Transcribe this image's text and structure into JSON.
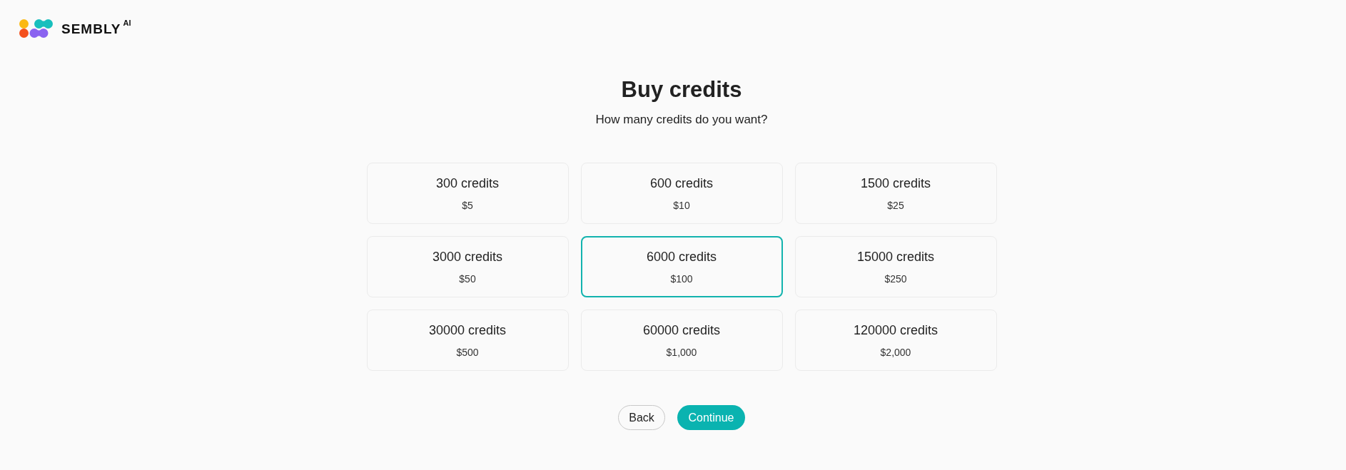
{
  "header": {
    "logo": {
      "wordmark": "SEMBLY",
      "superscript": "AI"
    }
  },
  "title": "Buy credits",
  "subtitle": "How many credits do you want?",
  "packages": [
    {
      "credits": "300 credits",
      "price": "$5",
      "selected": false
    },
    {
      "credits": "600 credits",
      "price": "$10",
      "selected": false
    },
    {
      "credits": "1500 credits",
      "price": "$25",
      "selected": false
    },
    {
      "credits": "3000 credits",
      "price": "$50",
      "selected": false
    },
    {
      "credits": "6000 credits",
      "price": "$100",
      "selected": true
    },
    {
      "credits": "15000 credits",
      "price": "$250",
      "selected": false
    },
    {
      "credits": "30000 credits",
      "price": "$500",
      "selected": false
    },
    {
      "credits": "60000 credits",
      "price": "$1,000",
      "selected": false
    },
    {
      "credits": "120000 credits",
      "price": "$2,000",
      "selected": false
    }
  ],
  "buttons": [
    {
      "label": "Back",
      "kind": "secondary"
    },
    {
      "label": "Continue",
      "kind": "primary"
    }
  ]
}
